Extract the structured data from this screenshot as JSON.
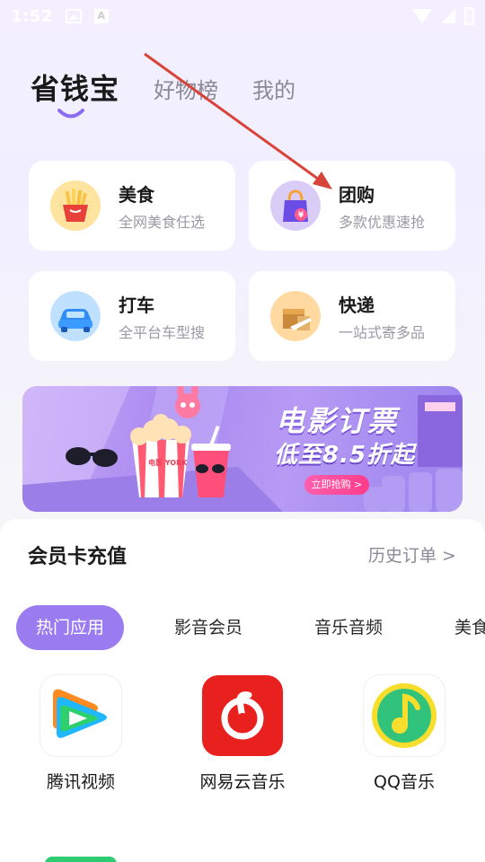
{
  "status_bar": {
    "time": "1:52"
  },
  "header": {
    "tabs": [
      {
        "label": "省钱宝",
        "active": true
      },
      {
        "label": "好物榜",
        "active": false
      },
      {
        "label": "我的",
        "active": false
      }
    ]
  },
  "services": [
    {
      "title": "美食",
      "subtitle": "全网美食任选",
      "icon": "fries-icon"
    },
    {
      "title": "团购",
      "subtitle": "多款优惠速抢",
      "icon": "shopping-bag-icon"
    },
    {
      "title": "打车",
      "subtitle": "全平台车型搜",
      "icon": "car-icon"
    },
    {
      "title": "快递",
      "subtitle": "一站式寄多品",
      "icon": "parcel-icon"
    }
  ],
  "banner": {
    "title": "电影订票",
    "subtitle": "低至8.5折起",
    "button": "立即抢购 >",
    "popcorn_text": "电影 YORK"
  },
  "member": {
    "title": "会员卡充值",
    "history": "历史订单 >",
    "categories": [
      {
        "label": "热门应用",
        "active": true
      },
      {
        "label": "影音会员",
        "active": false
      },
      {
        "label": "音乐音频",
        "active": false
      },
      {
        "label": "美食",
        "active": false
      }
    ],
    "apps": [
      {
        "label": "腾讯视频",
        "icon": "tencent-video-icon"
      },
      {
        "label": "网易云音乐",
        "icon": "netease-music-icon"
      },
      {
        "label": "QQ音乐",
        "icon": "qq-music-icon"
      }
    ]
  },
  "colors": {
    "accent": "#9b7cf0",
    "annotation_arrow": "#d9443a"
  }
}
